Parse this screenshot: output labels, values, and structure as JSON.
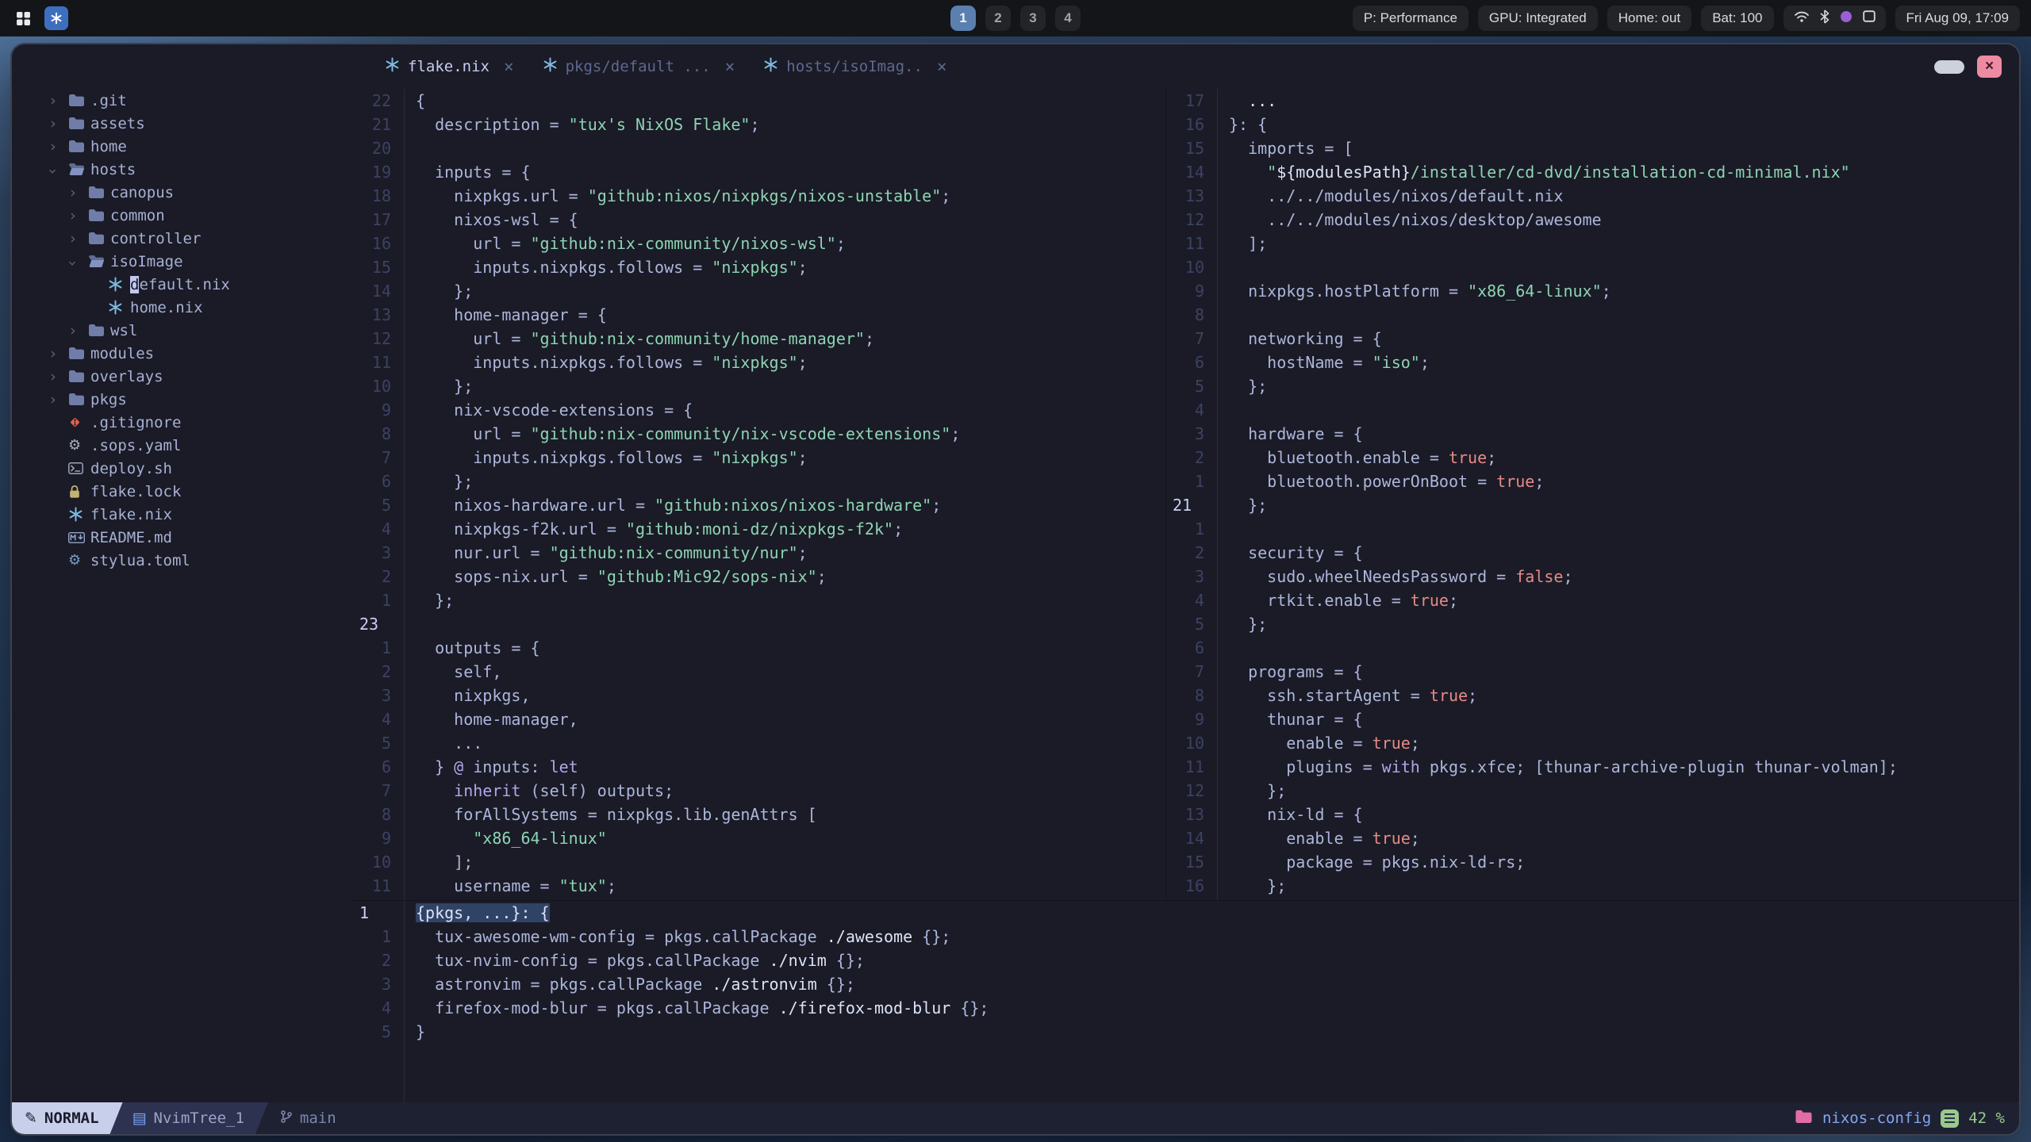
{
  "colors": {
    "accent_blue": "#7aa2f7",
    "nix_blue": "#7ebae4",
    "string_green": "#8ed4b4",
    "boolean_red": "#e78a88",
    "keyword_violet": "#b3a5e8",
    "project_pink": "#e06ca6",
    "scroll_green": "#9ac98a",
    "close_red": "#ee8ba2",
    "workspace_active": "#5b7fae",
    "editor_bg": "#1a1b26"
  },
  "glyphs": {
    "chevron": "›",
    "pencil": "✎",
    "tree_buffer": "▤",
    "close": "×"
  },
  "topbar": {
    "workspaces": [
      "1",
      "2",
      "3",
      "4"
    ],
    "active_workspace": "1",
    "status_pills": [
      "P: Performance",
      "GPU: Integrated",
      "Home: out",
      "Bat: 100"
    ],
    "tray_icons": [
      "wifi-icon",
      "bluetooth-icon",
      "accent-dot-icon",
      "screen-icon"
    ],
    "clock": "Fri Aug 09, 17:09"
  },
  "tabline": {
    "tabs": [
      {
        "label": "flake.nix",
        "active": true
      },
      {
        "label": "pkgs/default ...",
        "active": false
      },
      {
        "label": "hosts/isoImag..",
        "active": false
      }
    ],
    "close_symbol": "×"
  },
  "filetree": {
    "items": [
      {
        "label": ".git",
        "depth": 0,
        "kind": "folder"
      },
      {
        "label": "assets",
        "depth": 0,
        "kind": "folder"
      },
      {
        "label": "home",
        "depth": 0,
        "kind": "folder"
      },
      {
        "label": "hosts",
        "depth": 0,
        "kind": "folder-open",
        "expanded": true
      },
      {
        "label": "canopus",
        "depth": 1,
        "kind": "folder"
      },
      {
        "label": "common",
        "depth": 1,
        "kind": "folder"
      },
      {
        "label": "controller",
        "depth": 1,
        "kind": "folder"
      },
      {
        "label": "isoImage",
        "depth": 1,
        "kind": "folder-open",
        "expanded": true
      },
      {
        "label": "default.nix",
        "depth": 2,
        "kind": "nix",
        "cursor": true
      },
      {
        "label": "home.nix",
        "depth": 2,
        "kind": "nix"
      },
      {
        "label": "wsl",
        "depth": 1,
        "kind": "folder"
      },
      {
        "label": "modules",
        "depth": 0,
        "kind": "folder"
      },
      {
        "label": "overlays",
        "depth": 0,
        "kind": "folder"
      },
      {
        "label": "pkgs",
        "depth": 0,
        "kind": "folder"
      },
      {
        "label": ".gitignore",
        "depth": 0,
        "kind": "git"
      },
      {
        "label": ".sops.yaml",
        "depth": 0,
        "kind": "yaml"
      },
      {
        "label": "deploy.sh",
        "depth": 0,
        "kind": "shell"
      },
      {
        "label": "flake.lock",
        "depth": 0,
        "kind": "lock"
      },
      {
        "label": "flake.nix",
        "depth": 0,
        "kind": "nix"
      },
      {
        "label": "README.md",
        "depth": 0,
        "kind": "markdown"
      },
      {
        "label": "stylua.toml",
        "depth": 0,
        "kind": "toml"
      }
    ]
  },
  "panes": {
    "flake": {
      "lines": [
        {
          "n": "22",
          "segs": [
            [
              "t",
              "{"
            ]
          ]
        },
        {
          "n": "21",
          "segs": [
            [
              "t",
              "  description = "
            ],
            [
              "s",
              "\"tux's NixOS Flake\""
            ],
            [
              "t",
              ";"
            ]
          ]
        },
        {
          "n": "20",
          "segs": []
        },
        {
          "n": "19",
          "segs": [
            [
              "t",
              "  inputs = {"
            ]
          ]
        },
        {
          "n": "18",
          "segs": [
            [
              "t",
              "    nixpkgs.url = "
            ],
            [
              "s",
              "\"github:nixos/nixpkgs/nixos-unstable\""
            ],
            [
              "t",
              ";"
            ]
          ]
        },
        {
          "n": "17",
          "segs": [
            [
              "t",
              "    nixos-wsl = {"
            ]
          ]
        },
        {
          "n": "16",
          "segs": [
            [
              "t",
              "      url = "
            ],
            [
              "s",
              "\"github:nix-community/nixos-wsl\""
            ],
            [
              "t",
              ";"
            ]
          ]
        },
        {
          "n": "15",
          "segs": [
            [
              "t",
              "      inputs.nixpkgs.follows = "
            ],
            [
              "s",
              "\"nixpkgs\""
            ],
            [
              "t",
              ";"
            ]
          ]
        },
        {
          "n": "14",
          "segs": [
            [
              "t",
              "    };"
            ]
          ]
        },
        {
          "n": "13",
          "segs": [
            [
              "t",
              "    home-manager = {"
            ]
          ]
        },
        {
          "n": "12",
          "segs": [
            [
              "t",
              "      url = "
            ],
            [
              "s",
              "\"github:nix-community/home-manager\""
            ],
            [
              "t",
              ";"
            ]
          ]
        },
        {
          "n": "11",
          "segs": [
            [
              "t",
              "      inputs.nixpkgs.follows = "
            ],
            [
              "s",
              "\"nixpkgs\""
            ],
            [
              "t",
              ";"
            ]
          ]
        },
        {
          "n": "10",
          "segs": [
            [
              "t",
              "    };"
            ]
          ]
        },
        {
          "n": "9",
          "segs": [
            [
              "t",
              "    nix-vscode-extensions = {"
            ]
          ]
        },
        {
          "n": "8",
          "segs": [
            [
              "t",
              "      url = "
            ],
            [
              "s",
              "\"github:nix-community/nix-vscode-extensions\""
            ],
            [
              "t",
              ";"
            ]
          ]
        },
        {
          "n": "7",
          "segs": [
            [
              "t",
              "      inputs.nixpkgs.follows = "
            ],
            [
              "s",
              "\"nixpkgs\""
            ],
            [
              "t",
              ";"
            ]
          ]
        },
        {
          "n": "6",
          "segs": [
            [
              "t",
              "    };"
            ]
          ]
        },
        {
          "n": "5",
          "segs": [
            [
              "t",
              "    nixos-hardware.url = "
            ],
            [
              "s",
              "\"github:nixos/nixos-hardware\""
            ],
            [
              "t",
              ";"
            ]
          ]
        },
        {
          "n": "4",
          "segs": [
            [
              "t",
              "    nixpkgs-f2k.url = "
            ],
            [
              "s",
              "\"github:moni-dz/nixpkgs-f2k\""
            ],
            [
              "t",
              ";"
            ]
          ]
        },
        {
          "n": "3",
          "segs": [
            [
              "t",
              "    nur.url = "
            ],
            [
              "s",
              "\"github:nix-community/nur\""
            ],
            [
              "t",
              ";"
            ]
          ]
        },
        {
          "n": "2",
          "segs": [
            [
              "t",
              "    sops-nix.url = "
            ],
            [
              "s",
              "\"github:Mic92/sops-nix\""
            ],
            [
              "t",
              ";"
            ]
          ]
        },
        {
          "n": "1",
          "segs": [
            [
              "t",
              "  };"
            ]
          ]
        },
        {
          "n": "23",
          "cur": true,
          "segs": []
        },
        {
          "n": "1",
          "segs": [
            [
              "t",
              "  outputs = {"
            ]
          ]
        },
        {
          "n": "2",
          "segs": [
            [
              "t",
              "    self,"
            ]
          ]
        },
        {
          "n": "3",
          "segs": [
            [
              "t",
              "    nixpkgs,"
            ]
          ]
        },
        {
          "n": "4",
          "segs": [
            [
              "t",
              "    home-manager,"
            ]
          ]
        },
        {
          "n": "5",
          "segs": [
            [
              "t",
              "    ..."
            ]
          ]
        },
        {
          "n": "6",
          "segs": [
            [
              "t",
              "  } "
            ],
            [
              "k",
              "@"
            ],
            [
              "t",
              " inputs: "
            ],
            [
              "k",
              "let"
            ]
          ]
        },
        {
          "n": "7",
          "segs": [
            [
              "t",
              "    "
            ],
            [
              "k",
              "inherit"
            ],
            [
              "t",
              " (self) outputs;"
            ]
          ]
        },
        {
          "n": "8",
          "segs": [
            [
              "t",
              "    forAllSystems = nixpkgs.lib.genAttrs ["
            ]
          ]
        },
        {
          "n": "9",
          "segs": [
            [
              "t",
              "      "
            ],
            [
              "s",
              "\"x86_64-linux\""
            ]
          ]
        },
        {
          "n": "10",
          "segs": [
            [
              "t",
              "    ];"
            ]
          ]
        },
        {
          "n": "11",
          "segs": [
            [
              "t",
              "    username = "
            ],
            [
              "s",
              "\"tux\""
            ],
            [
              "t",
              ";"
            ]
          ]
        }
      ]
    },
    "iso": {
      "lines": [
        {
          "n": "17",
          "segs": [
            [
              "w",
              "  ..."
            ]
          ]
        },
        {
          "n": "16",
          "segs": [
            [
              "t",
              "}: {"
            ]
          ]
        },
        {
          "n": "15",
          "segs": [
            [
              "t",
              "  imports = ["
            ]
          ]
        },
        {
          "n": "14",
          "segs": [
            [
              "t",
              "    "
            ],
            [
              "s",
              "\""
            ],
            [
              "w",
              "${modulesPath}"
            ],
            [
              "s",
              "/installer/cd-dvd/installation-cd-minimal.nix\""
            ]
          ]
        },
        {
          "n": "13",
          "segs": [
            [
              "t",
              "    ../../modules/nixos/default.nix"
            ]
          ]
        },
        {
          "n": "12",
          "segs": [
            [
              "t",
              "    ../../modules/nixos/desktop/awesome"
            ]
          ]
        },
        {
          "n": "11",
          "segs": [
            [
              "t",
              "  ];"
            ]
          ]
        },
        {
          "n": "10",
          "segs": []
        },
        {
          "n": "9",
          "segs": [
            [
              "t",
              "  nixpkgs.hostPlatform = "
            ],
            [
              "s",
              "\"x86_64-linux\""
            ],
            [
              "t",
              ";"
            ]
          ]
        },
        {
          "n": "8",
          "segs": []
        },
        {
          "n": "7",
          "segs": [
            [
              "t",
              "  networking = {"
            ]
          ]
        },
        {
          "n": "6",
          "segs": [
            [
              "t",
              "    hostName = "
            ],
            [
              "s",
              "\"iso\""
            ],
            [
              "t",
              ";"
            ]
          ]
        },
        {
          "n": "5",
          "segs": [
            [
              "t",
              "  };"
            ]
          ]
        },
        {
          "n": "4",
          "segs": []
        },
        {
          "n": "3",
          "segs": [
            [
              "t",
              "  hardware = {"
            ]
          ]
        },
        {
          "n": "2",
          "segs": [
            [
              "t",
              "    bluetooth.enable = "
            ],
            [
              "b",
              "true"
            ],
            [
              "t",
              ";"
            ]
          ]
        },
        {
          "n": "1",
          "segs": [
            [
              "t",
              "    bluetooth.powerOnBoot = "
            ],
            [
              "b",
              "true"
            ],
            [
              "t",
              ";"
            ]
          ]
        },
        {
          "n": "21",
          "cur": true,
          "segs": [
            [
              "t",
              "  };"
            ]
          ]
        },
        {
          "n": "1",
          "segs": []
        },
        {
          "n": "2",
          "segs": [
            [
              "t",
              "  security = {"
            ]
          ]
        },
        {
          "n": "3",
          "segs": [
            [
              "t",
              "    sudo.wheelNeedsPassword = "
            ],
            [
              "b",
              "false"
            ],
            [
              "t",
              ";"
            ]
          ]
        },
        {
          "n": "4",
          "segs": [
            [
              "t",
              "    rtkit.enable = "
            ],
            [
              "b",
              "true"
            ],
            [
              "t",
              ";"
            ]
          ]
        },
        {
          "n": "5",
          "segs": [
            [
              "t",
              "  };"
            ]
          ]
        },
        {
          "n": "6",
          "segs": []
        },
        {
          "n": "7",
          "segs": [
            [
              "t",
              "  programs = {"
            ]
          ]
        },
        {
          "n": "8",
          "segs": [
            [
              "t",
              "    ssh.startAgent = "
            ],
            [
              "b",
              "true"
            ],
            [
              "t",
              ";"
            ]
          ]
        },
        {
          "n": "9",
          "segs": [
            [
              "t",
              "    thunar = {"
            ]
          ]
        },
        {
          "n": "10",
          "segs": [
            [
              "t",
              "      enable = "
            ],
            [
              "b",
              "true"
            ],
            [
              "t",
              ";"
            ]
          ]
        },
        {
          "n": "11",
          "segs": [
            [
              "t",
              "      plugins = "
            ],
            [
              "k",
              "with"
            ],
            [
              "t",
              " pkgs.xfce; [thunar-archive-plugin thunar-volman];"
            ]
          ]
        },
        {
          "n": "12",
          "segs": [
            [
              "t",
              "    };"
            ]
          ]
        },
        {
          "n": "13",
          "segs": [
            [
              "t",
              "    nix-ld = {"
            ]
          ]
        },
        {
          "n": "14",
          "segs": [
            [
              "t",
              "      enable = "
            ],
            [
              "b",
              "true"
            ],
            [
              "t",
              ";"
            ]
          ]
        },
        {
          "n": "15",
          "segs": [
            [
              "t",
              "      package = pkgs.nix-ld-rs;"
            ]
          ]
        },
        {
          "n": "16",
          "segs": [
            [
              "t",
              "    };"
            ]
          ]
        }
      ]
    },
    "pkgs": {
      "lines": [
        {
          "n": "1",
          "cur": true,
          "hl": true,
          "segs": [
            [
              "w",
              "{pkgs, ...}: {"
            ]
          ]
        },
        {
          "n": "1",
          "segs": [
            [
              "t",
              "  tux-awesome-wm-config = pkgs.callPackage "
            ],
            [
              "w",
              "./awesome"
            ],
            [
              "t",
              " {};"
            ]
          ]
        },
        {
          "n": "2",
          "segs": [
            [
              "t",
              "  tux-nvim-config = pkgs.callPackage "
            ],
            [
              "w",
              "./nvim"
            ],
            [
              "t",
              " {};"
            ]
          ]
        },
        {
          "n": "3",
          "segs": [
            [
              "t",
              "  astronvim = pkgs.callPackage "
            ],
            [
              "w",
              "./astronvim"
            ],
            [
              "t",
              " {};"
            ]
          ]
        },
        {
          "n": "4",
          "segs": [
            [
              "t",
              "  firefox-mod-blur = pkgs.callPackage "
            ],
            [
              "w",
              "./firefox-mod-blur"
            ],
            [
              "t",
              " {};"
            ]
          ]
        },
        {
          "n": "5",
          "segs": [
            [
              "t",
              "}"
            ]
          ]
        }
      ]
    }
  },
  "statusline": {
    "mode": "NORMAL",
    "buffer": "NvimTree_1",
    "branch": "main",
    "project": "nixos-config",
    "scroll": "42 %"
  }
}
